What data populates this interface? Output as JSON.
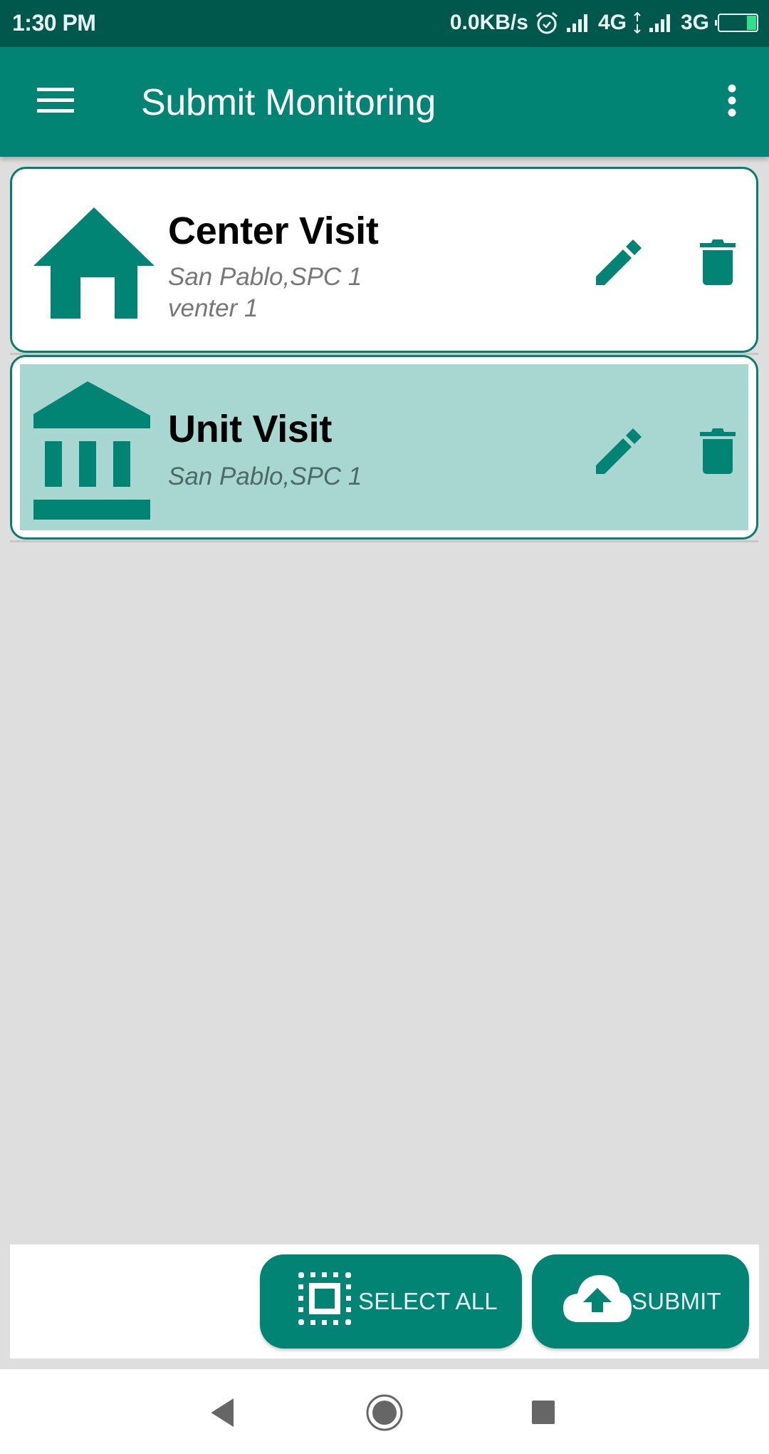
{
  "status_bar": {
    "time": "1:30 PM",
    "network_speed": "0.0KB/s",
    "alarm_icon": "alarm-clock-icon",
    "sim1_type": "4G",
    "sim2_type": "3G",
    "battery_icon": "battery-icon",
    "battery_color": "#2ee08a"
  },
  "app_bar": {
    "menu_icon": "hamburger-menu-icon",
    "title": "Submit Monitoring",
    "overflow_icon": "more-vertical-icon",
    "background_color": "#028475"
  },
  "visits": [
    {
      "title": "Center Visit",
      "subtitle_lines": [
        "San Pablo,SPC 1",
        "venter 1"
      ],
      "icon": "home-icon",
      "selected": false,
      "edit_icon": "pencil-icon",
      "delete_icon": "trash-icon"
    },
    {
      "title": "Unit Visit",
      "subtitle_lines": [
        "San Pablo,SPC 1"
      ],
      "icon": "institution-icon",
      "selected": true,
      "edit_icon": "pencil-icon",
      "delete_icon": "trash-icon"
    }
  ],
  "actions": {
    "select_all_label": "SELECT ALL",
    "select_all_icon": "select-all-icon",
    "submit_label": "SUBMIT",
    "submit_icon": "cloud-upload-icon"
  },
  "nav_bar": {
    "back_icon": "back-triangle-icon",
    "home_icon": "home-circle-icon",
    "recents_icon": "recents-square-icon"
  },
  "colors": {
    "accent": "#028475",
    "status_bar": "#00574b",
    "selected_tint": "#a8d6d1",
    "background": "#dedede"
  }
}
